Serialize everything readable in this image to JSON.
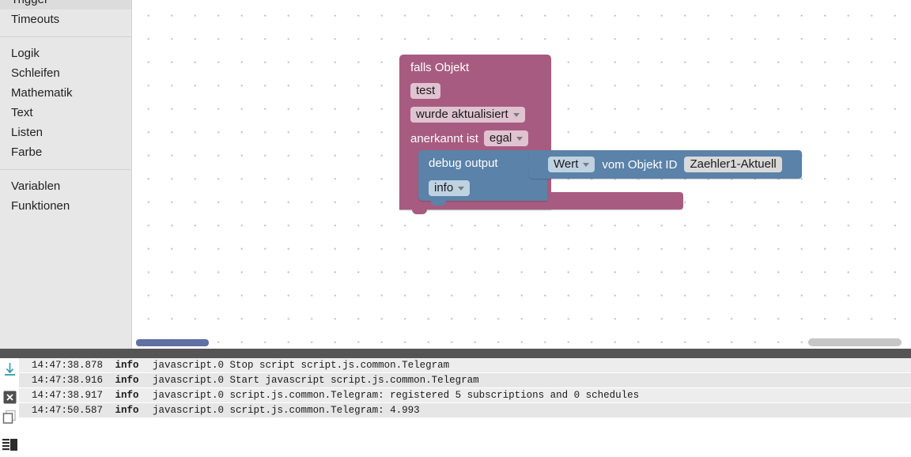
{
  "toolbox": {
    "groups": [
      {
        "items": [
          {
            "label": "Trigger"
          },
          {
            "label": "Timeouts"
          }
        ]
      },
      {
        "items": [
          {
            "label": "Logik"
          },
          {
            "label": "Schleifen"
          },
          {
            "label": "Mathematik"
          },
          {
            "label": "Text"
          },
          {
            "label": "Listen"
          },
          {
            "label": "Farbe"
          }
        ]
      },
      {
        "items": [
          {
            "label": "Variablen"
          },
          {
            "label": "Funktionen"
          }
        ]
      }
    ]
  },
  "workspace": {
    "blocks": {
      "if_object": {
        "title": "falls Objekt",
        "object_id": "test",
        "event": "wurde aktualisiert",
        "ack_label": "anerkannt ist",
        "ack_value": "egal",
        "color": "#a85b80"
      },
      "debug_output": {
        "label": "debug output",
        "severity": "info",
        "color": "#5b82a8"
      },
      "get_value": {
        "attribute": "Wert",
        "label": "vom Objekt ID",
        "object_id": "Zaehler1-Aktuell",
        "color": "#5b82a8"
      }
    }
  },
  "log": {
    "tools": [
      {
        "name": "download-icon"
      },
      {
        "name": "clear-icon"
      },
      {
        "name": "copy-icon"
      },
      {
        "name": "list-icon"
      }
    ],
    "rows": [
      {
        "time": "14:47:38.878",
        "severity": "info",
        "message": "javascript.0 Stop script script.js.common.Telegram"
      },
      {
        "time": "14:47:38.916",
        "severity": "info",
        "message": "javascript.0 Start javascript script.js.common.Telegram"
      },
      {
        "time": "14:47:38.917",
        "severity": "info",
        "message": "javascript.0 script.js.common.Telegram: registered 5 subscriptions and 0 schedules"
      },
      {
        "time": "14:47:50.587",
        "severity": "info",
        "message": "javascript.0 script.js.common.Telegram: 4.993"
      }
    ]
  }
}
